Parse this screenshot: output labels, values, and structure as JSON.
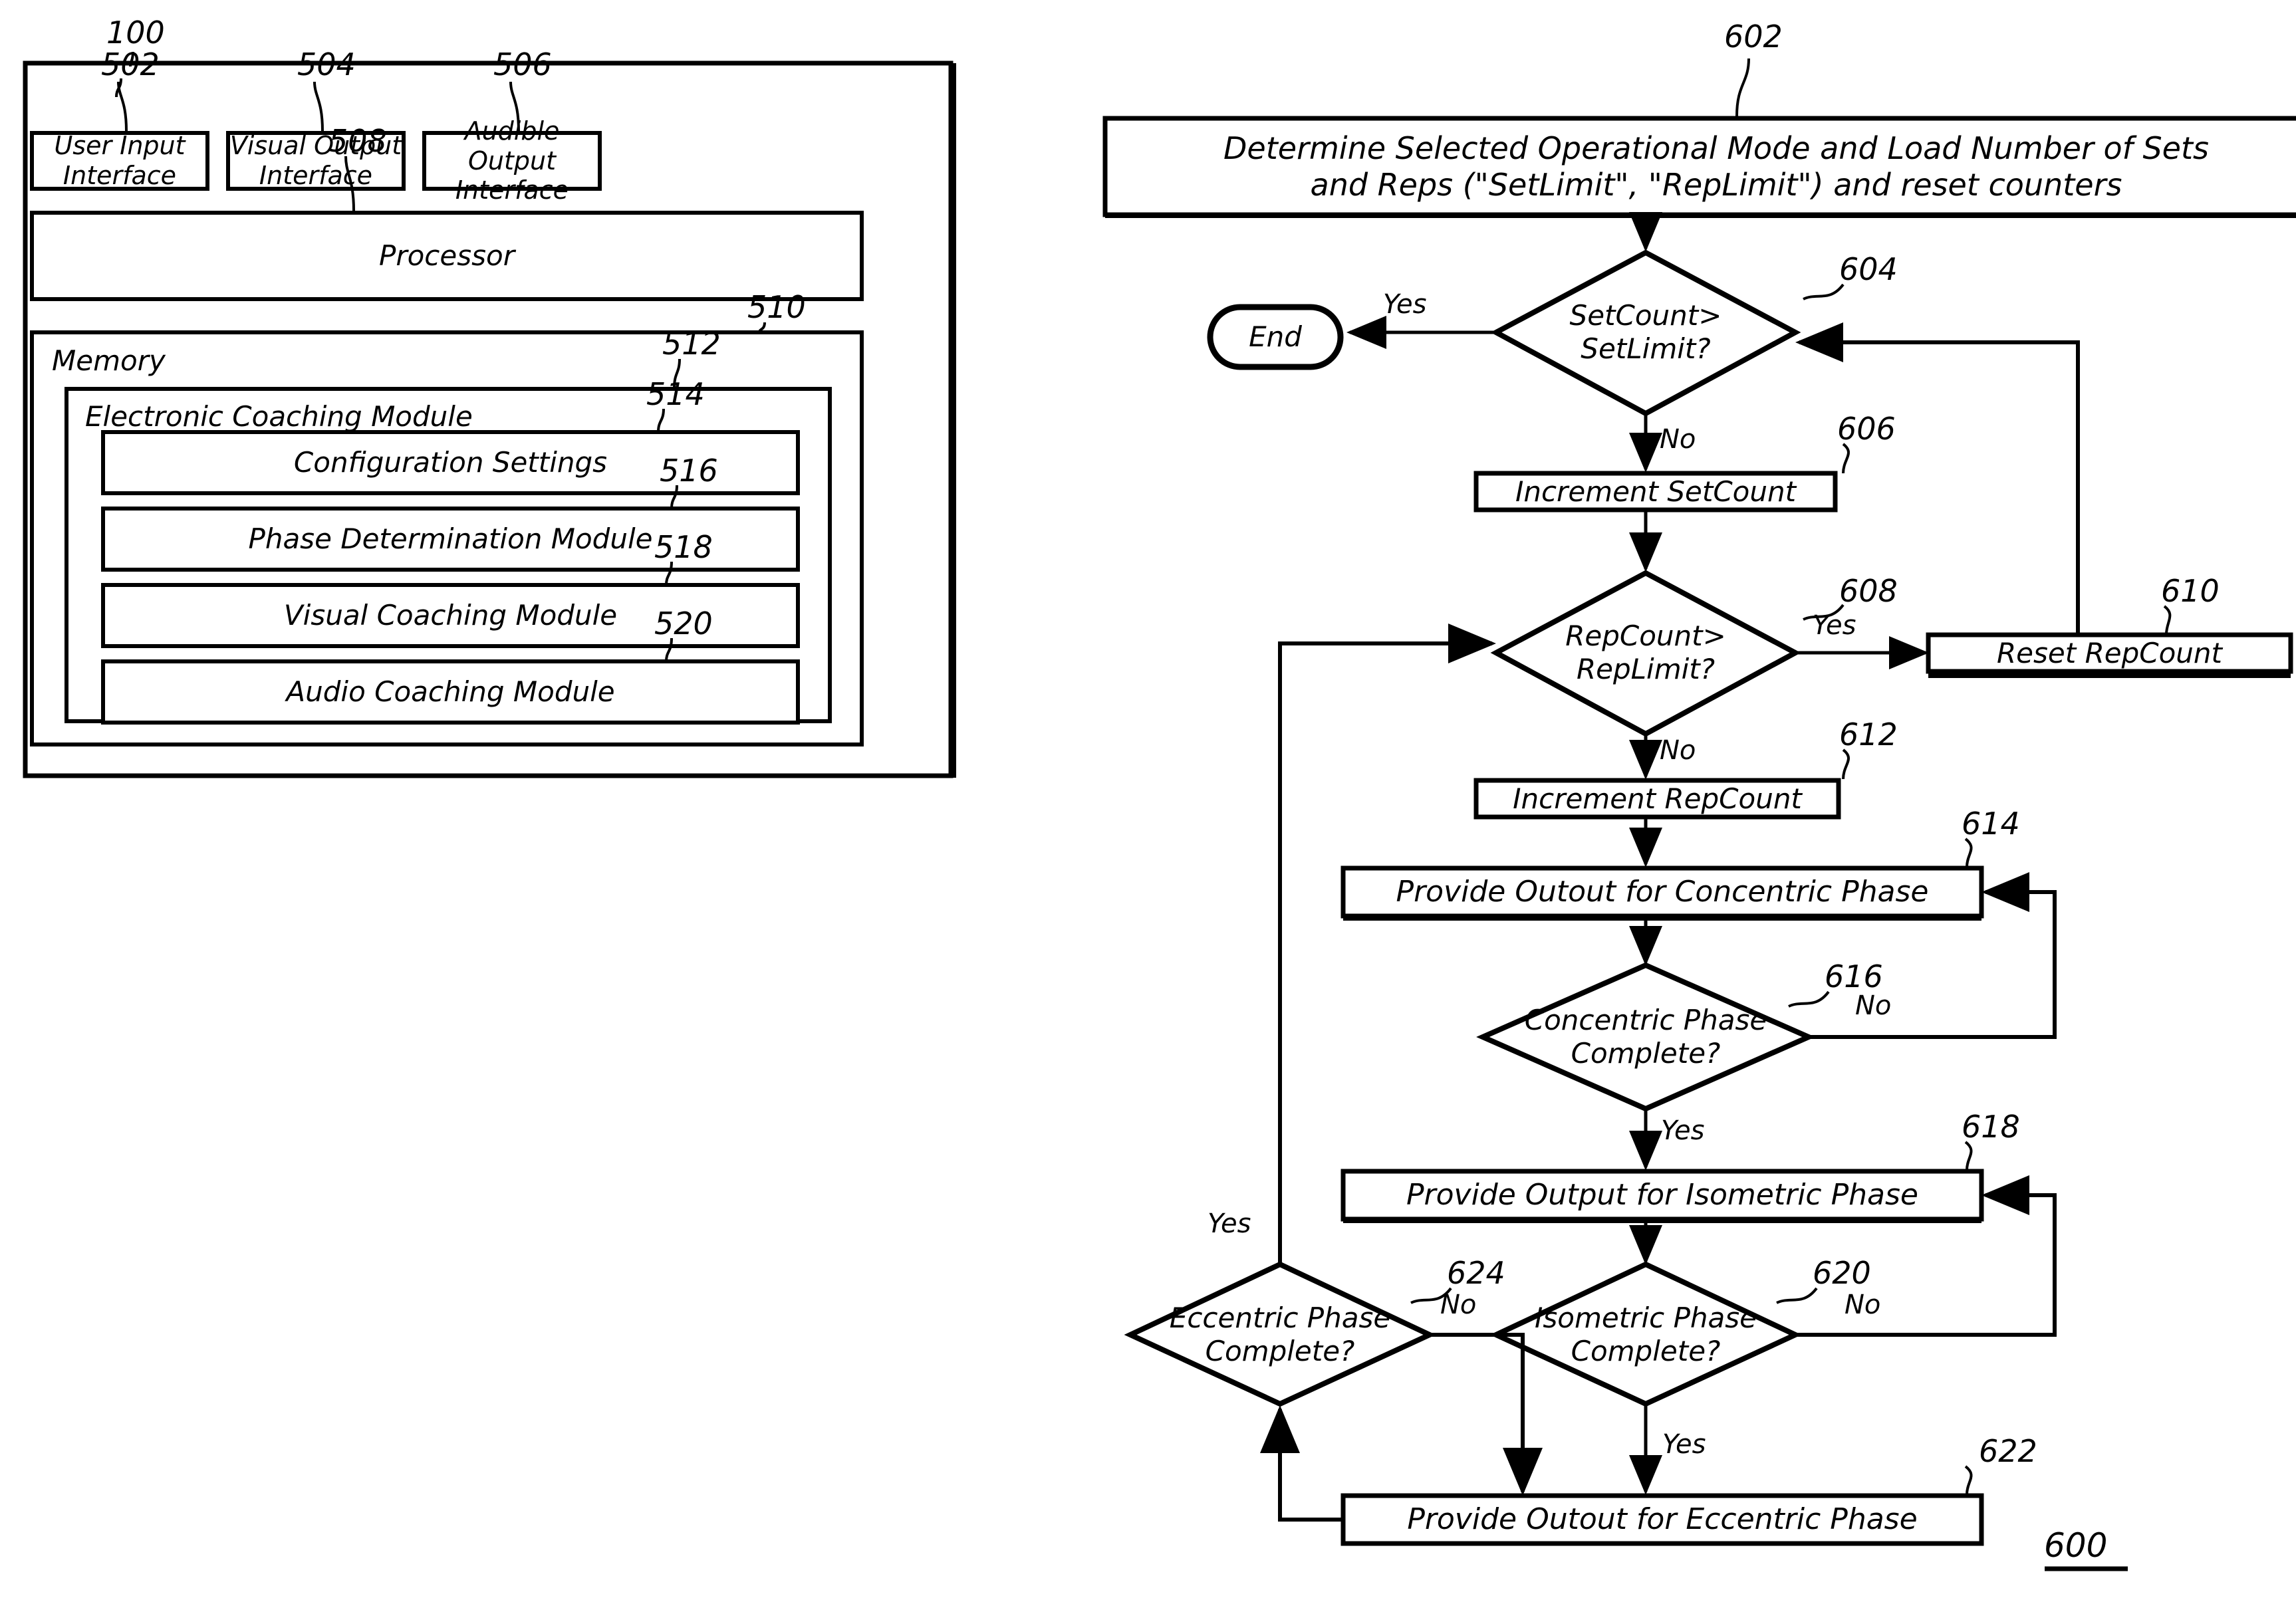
{
  "figure_left": {
    "ref": "100",
    "outer_label": "100",
    "boxes": [
      {
        "id": "502",
        "label": "User Input\nInterface"
      },
      {
        "id": "504",
        "label": "Visual Output\nInterface"
      },
      {
        "id": "506",
        "label": "Audible Output\nInterface"
      },
      {
        "id": "508",
        "label": "Processor"
      },
      {
        "id": "510",
        "label": "Memory"
      },
      {
        "id": "512",
        "label": "Electronic Coaching Module"
      },
      {
        "id": "514",
        "label": "Configuration Settings"
      },
      {
        "id": "516",
        "label": "Phase Determination Module"
      },
      {
        "id": "518",
        "label": "Visual Coaching Module"
      },
      {
        "id": "520",
        "label": "Audio Coaching Module"
      }
    ]
  },
  "figure_right": {
    "ref": "600",
    "nodes": [
      {
        "id": "602",
        "type": "process",
        "label": "Determine Selected Operational Mode and Load Number of Sets\nand Reps (\"SetLimit\", \"RepLimit\") and reset counters"
      },
      {
        "id": "604",
        "type": "decision",
        "label": "SetCount>\nSetLimit?"
      },
      {
        "id": "end",
        "type": "terminator",
        "label": "End"
      },
      {
        "id": "606",
        "type": "process",
        "label": "Increment SetCount"
      },
      {
        "id": "608",
        "type": "decision",
        "label": "RepCount>\nRepLimit?"
      },
      {
        "id": "610",
        "type": "process",
        "label": "Reset RepCount"
      },
      {
        "id": "612",
        "type": "process",
        "label": "Increment RepCount"
      },
      {
        "id": "614",
        "type": "process",
        "label": "Provide Outout for Concentric Phase"
      },
      {
        "id": "616",
        "type": "decision",
        "label": "Concentric Phase\nComplete?"
      },
      {
        "id": "618",
        "type": "process",
        "label": "Provide Output for Isometric Phase"
      },
      {
        "id": "620",
        "type": "decision",
        "label": "Isometric Phase\nComplete?"
      },
      {
        "id": "622",
        "type": "process",
        "label": "Provide Outout for Eccentric Phase"
      },
      {
        "id": "624",
        "type": "decision",
        "label": "Eccentric Phase\nComplete?"
      }
    ],
    "edge_labels": {
      "e604_yes": "Yes",
      "e604_no": "No",
      "e608_yes": "Yes",
      "e608_no": "No",
      "e616_no": "No",
      "e616_yes": "Yes",
      "e620_no": "No",
      "e620_yes": "Yes",
      "e624_no": "No",
      "e624_yes": "Yes"
    }
  },
  "colors": {
    "ink": "#000000",
    "paper": "#ffffff"
  }
}
